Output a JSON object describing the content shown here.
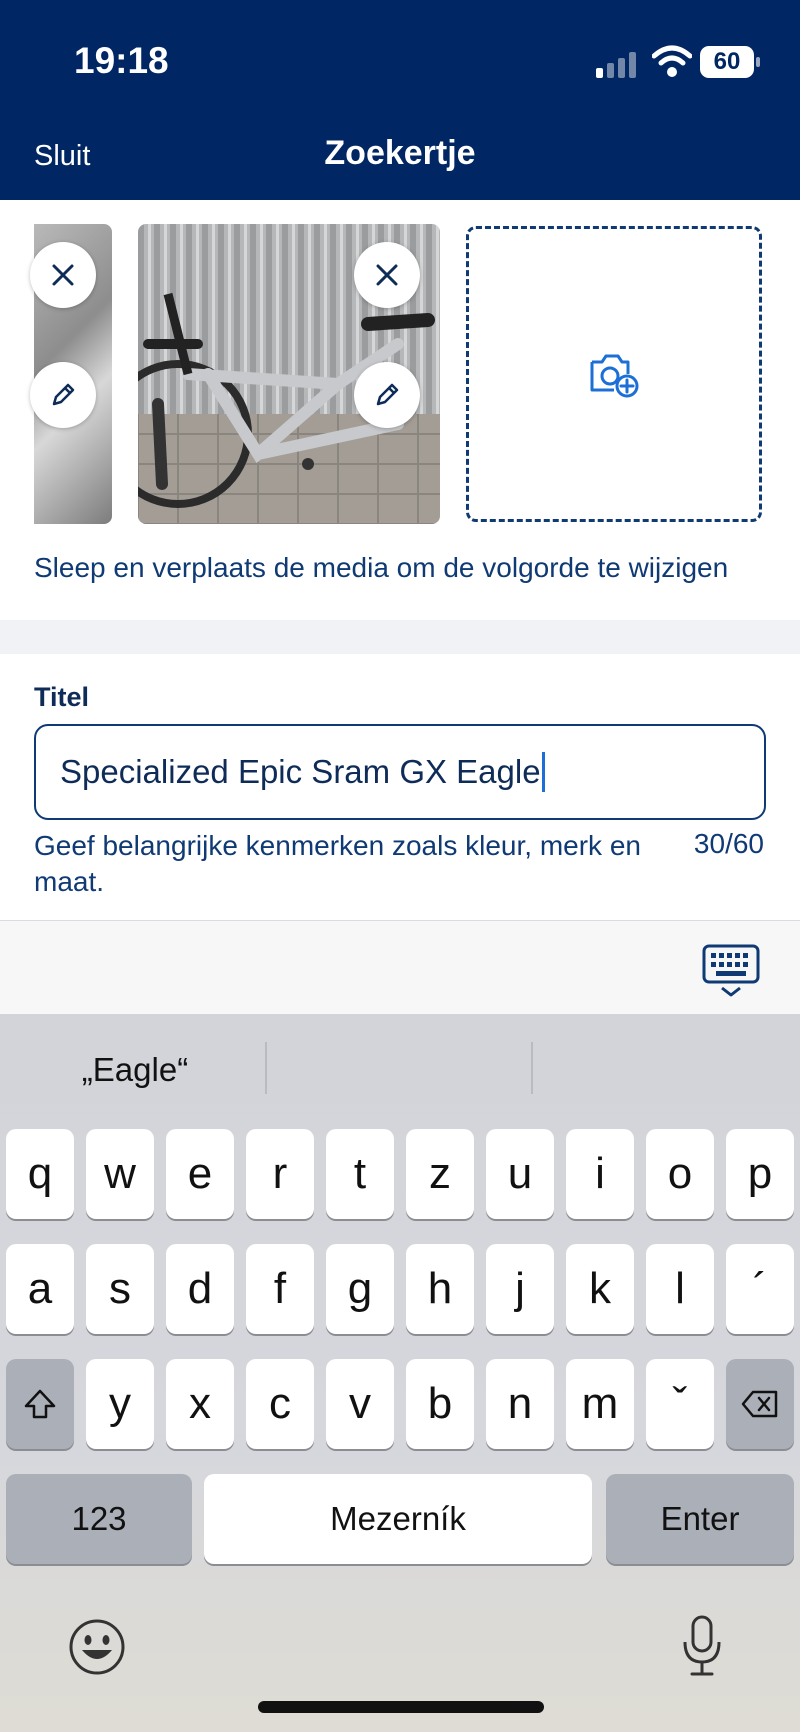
{
  "status": {
    "time": "19:18",
    "battery": "60"
  },
  "header": {
    "close_label": "Sluit",
    "title": "Zoekertje"
  },
  "media": {
    "hint": "Sleep en verplaats de media om de volgorde te wijzigen"
  },
  "form": {
    "title_label": "Titel",
    "title_value": "Specialized Epic Sram GX Eagle",
    "help_text": "Geef belangrijke kenmerken zoals kleur, merk en maat.",
    "counter": "30/60"
  },
  "keyboard": {
    "suggestions": [
      "„Eagle“",
      "",
      ""
    ],
    "row1": [
      "q",
      "w",
      "e",
      "r",
      "t",
      "z",
      "u",
      "i",
      "o",
      "p"
    ],
    "row2": [
      "a",
      "s",
      "d",
      "f",
      "g",
      "h",
      "j",
      "k",
      "l",
      "´"
    ],
    "row3": [
      "y",
      "x",
      "c",
      "v",
      "b",
      "n",
      "m",
      "ˇ"
    ],
    "numbers": "123",
    "space": "Mezerník",
    "enter": "Enter"
  },
  "colors": {
    "header_bg": "#002663",
    "accent": "#1c6fd6",
    "text_dark": "#0e2c57"
  },
  "icons": [
    "signal-icon",
    "wifi-icon",
    "battery-icon",
    "remove-icon",
    "edit-icon",
    "add-photo-icon",
    "keyboard-dismiss-icon",
    "shift-icon",
    "backspace-icon",
    "emoji-icon",
    "microphone-icon"
  ]
}
